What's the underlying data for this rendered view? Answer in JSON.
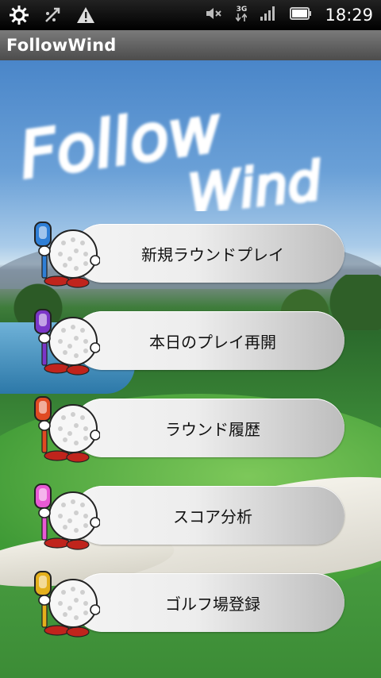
{
  "status_bar": {
    "icons": [
      "settings-icon",
      "debug-usb-icon",
      "warning-icon"
    ],
    "right_icons": [
      "mute-icon",
      "network-3g-icon",
      "signal-icon",
      "battery-icon"
    ],
    "network_label": "3G",
    "clock": "18:29"
  },
  "title_bar": {
    "title": "FollowWind"
  },
  "logo": {
    "text_line1": "Follow",
    "text_line2": "Wind"
  },
  "menu": {
    "items": [
      {
        "label": "新規ラウンドプレイ",
        "flag_color": "#2f7fd6"
      },
      {
        "label": "本日のプレイ再開",
        "flag_color": "#7b36c8"
      },
      {
        "label": "ラウンド履歴",
        "flag_color": "#e04a22"
      },
      {
        "label": "スコア分析",
        "flag_color": "#e85ad4"
      },
      {
        "label": "ゴルフ場登録",
        "flag_color": "#e4b01c"
      }
    ]
  }
}
